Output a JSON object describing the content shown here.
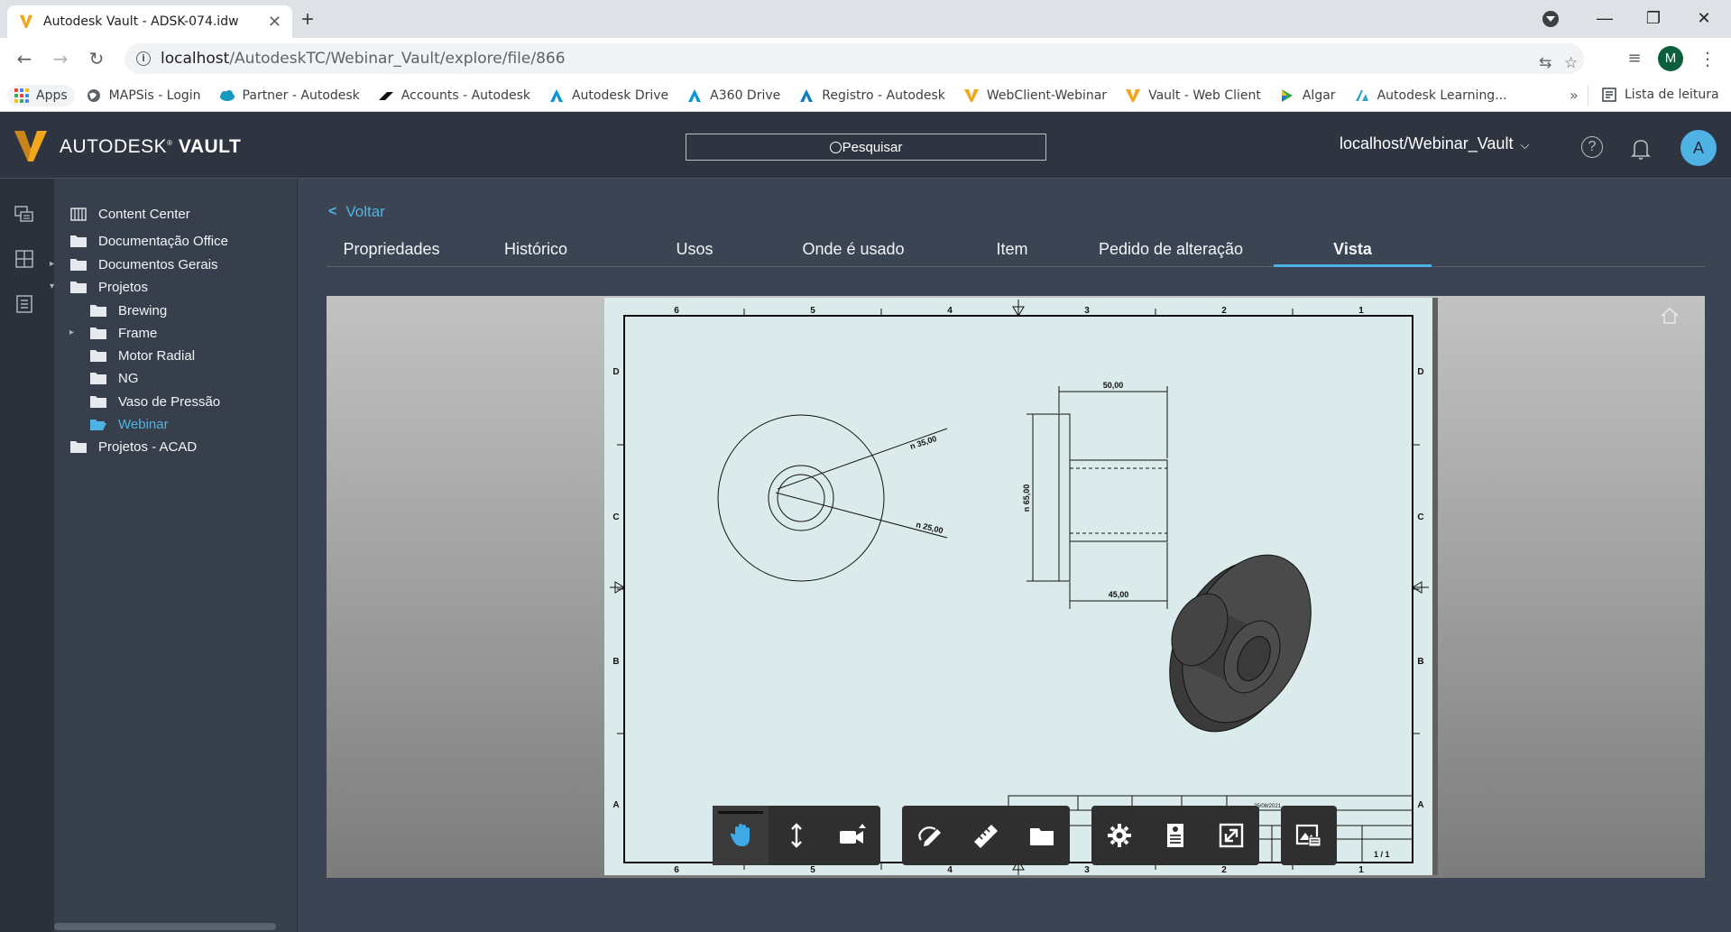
{
  "browser": {
    "tab_title": "Autodesk Vault - ADSK-074.idw",
    "tab_close": "✕",
    "new_tab": "+",
    "url_host": "localhost",
    "url_path": "/AutodeskTC/Webinar_Vault/explore/file/866",
    "profile_initial": "M",
    "bookmarks": [
      {
        "label": "Apps",
        "icon": "apps-grid-icon"
      },
      {
        "label": "MAPSis - Login",
        "icon": "globe-icon"
      },
      {
        "label": "Partner - Autodesk",
        "icon": "salesforce-cloud-icon"
      },
      {
        "label": "Accounts - Autodesk",
        "icon": "autodesk-accounts-icon"
      },
      {
        "label": "Autodesk Drive",
        "icon": "autodesk-a-icon"
      },
      {
        "label": "A360 Drive",
        "icon": "autodesk-a-icon"
      },
      {
        "label": "Registro - Autodesk",
        "icon": "autodesk-a-icon"
      },
      {
        "label": "WebClient-Webinar",
        "icon": "vault-v-icon"
      },
      {
        "label": "Vault - Web Client",
        "icon": "vault-v-icon"
      },
      {
        "label": "Algar",
        "icon": "algar-icon"
      },
      {
        "label": "Autodesk Learning...",
        "icon": "autodesk-learning-icon"
      }
    ],
    "bookmarks_more": "»",
    "reading_list": "Lista de leitura"
  },
  "vault": {
    "brand_prefix": "AUTODESK",
    "brand_name": "VAULT",
    "search_placeholder": "Pesquisar",
    "server": "localhost/Webinar_Vault",
    "help": "?",
    "user_initial": "A"
  },
  "tree": [
    {
      "label": "Content Center",
      "level": 0,
      "icon": "content-center-icon",
      "expander": "",
      "active": false
    },
    {
      "label": "Documentação Office",
      "level": 0,
      "icon": "folder-icon",
      "expander": "",
      "active": false
    },
    {
      "label": "Documentos Gerais",
      "level": 0,
      "icon": "folder-icon",
      "expander": "▸",
      "active": false
    },
    {
      "label": "Projetos",
      "level": 0,
      "icon": "folder-icon",
      "expander": "▾",
      "active": false
    },
    {
      "label": "Brewing",
      "level": 1,
      "icon": "folder-icon",
      "expander": "",
      "active": false
    },
    {
      "label": "Frame",
      "level": 1,
      "icon": "folder-icon",
      "expander": "▸",
      "active": false
    },
    {
      "label": "Motor Radial",
      "level": 1,
      "icon": "folder-icon",
      "expander": "",
      "active": false
    },
    {
      "label": "NG",
      "level": 1,
      "icon": "folder-icon",
      "expander": "",
      "active": false
    },
    {
      "label": "Vaso de Pressão",
      "level": 1,
      "icon": "folder-icon",
      "expander": "",
      "active": false
    },
    {
      "label": "Webinar",
      "level": 1,
      "icon": "folder-open-icon",
      "expander": "",
      "active": true
    },
    {
      "label": "Projetos - ACAD",
      "level": 0,
      "icon": "folder-icon",
      "expander": "",
      "active": false
    }
  ],
  "main": {
    "back_label": "Voltar",
    "tabs": [
      {
        "label": "Propriedades",
        "active": false
      },
      {
        "label": "Histórico",
        "active": false
      },
      {
        "label": "Usos",
        "active": false
      },
      {
        "label": "Onde é usado",
        "active": false
      },
      {
        "label": "Item",
        "active": false
      },
      {
        "label": "Pedido de alteração",
        "active": false
      },
      {
        "label": "Vista",
        "active": true
      }
    ]
  },
  "drawing": {
    "border_numbers": [
      "6",
      "5",
      "4",
      "3",
      "2",
      "1"
    ],
    "border_letters": [
      "D",
      "C",
      "B",
      "A"
    ],
    "dim_top": "50,00",
    "dim_bottom": "45,00",
    "dim_height": "n 65,00",
    "dim_outer": "n 35,00",
    "dim_inner": "n 25,00",
    "sheet": "1 / 1",
    "title_block_date": "25/08/2021"
  },
  "viewer_tools": [
    {
      "name": "pan-tool",
      "icon": "hand-icon",
      "active": true
    },
    {
      "name": "zoom-tool",
      "icon": "zoom-arrows-icon",
      "active": false
    },
    {
      "name": "camera-tool",
      "icon": "video-camera-icon",
      "active": false
    },
    {
      "name": "markup-tool",
      "icon": "markup-pen-icon",
      "active": false
    },
    {
      "name": "measure-tool",
      "icon": "ruler-icon",
      "active": false
    },
    {
      "name": "sheets-tool",
      "icon": "folder-icon",
      "active": false
    },
    {
      "name": "settings-tool",
      "icon": "gear-icon",
      "active": false
    },
    {
      "name": "properties-tool",
      "icon": "properties-icon",
      "active": false
    },
    {
      "name": "fullscreen-tool",
      "icon": "fullscreen-icon",
      "active": false
    },
    {
      "name": "image-export-tool",
      "icon": "image-export-icon",
      "active": false
    }
  ],
  "colors": {
    "accent": "#4eb3e4",
    "vault_header": "#2e3440",
    "panel": "#383f4c",
    "sheet": "#dbeaea",
    "vault_logo": "#f0a71b"
  }
}
